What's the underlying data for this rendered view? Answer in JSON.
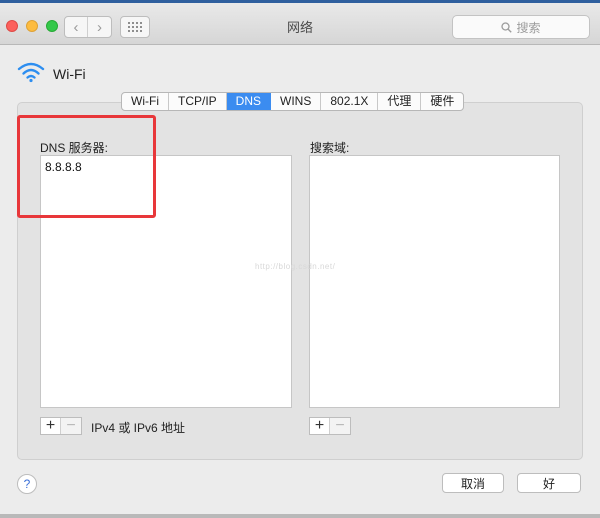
{
  "window": {
    "title": "网络"
  },
  "toolbar": {
    "back_icon": "chevron-left-icon",
    "forward_icon": "chevron-right-icon",
    "grid_icon": "grid-icon",
    "search_placeholder": "搜索"
  },
  "interface": {
    "name": "Wi-Fi",
    "icon": "wifi-icon"
  },
  "tabs": [
    {
      "label": "Wi-Fi",
      "active": false
    },
    {
      "label": "TCP/IP",
      "active": false
    },
    {
      "label": "DNS",
      "active": true
    },
    {
      "label": "WINS",
      "active": false
    },
    {
      "label": "802.1X",
      "active": false
    },
    {
      "label": "代理",
      "active": false
    },
    {
      "label": "硬件",
      "active": false
    }
  ],
  "dns": {
    "servers_label": "DNS 服务器:",
    "servers": [
      "8.8.8.8"
    ],
    "footnote": "IPv4 或 IPv6 地址",
    "search_domains_label": "搜索域:",
    "search_domains": []
  },
  "controls": {
    "add": "+",
    "remove": "−"
  },
  "watermark": "http://blog.csdn.net/",
  "buttons": {
    "help": "?",
    "cancel": "取消",
    "ok": "好"
  },
  "colors": {
    "highlight": "#e8373a",
    "accent": "#3b8cf0"
  }
}
